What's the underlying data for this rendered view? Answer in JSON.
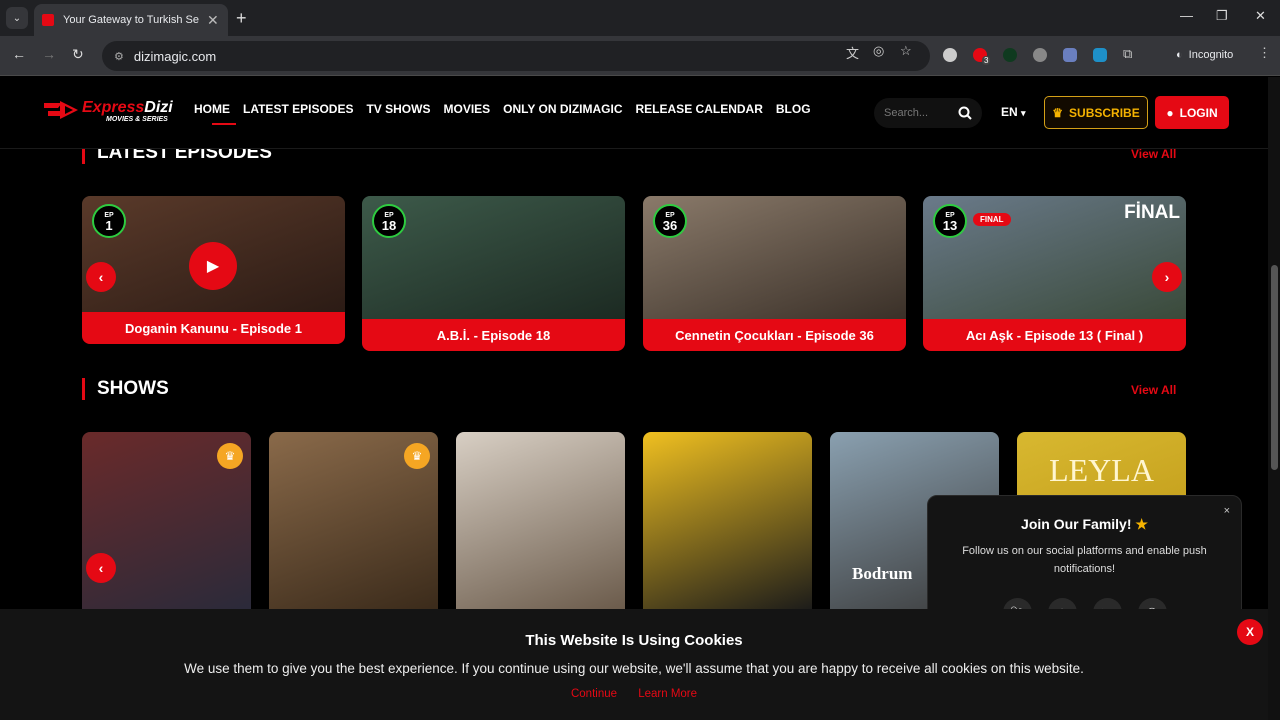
{
  "browser": {
    "tab_title": "Your Gateway to Turkish Series",
    "tab_close": "✕",
    "new_tab": "+",
    "url": "dizimagic.com",
    "incognito_label": "Incognito",
    "window_controls": {
      "minimize": "—",
      "maximize": "❐",
      "close": "✕"
    },
    "extension_badge": "3"
  },
  "header": {
    "logo_express": "Express",
    "logo_dizi": "Dizi",
    "logo_tagline": "MOVIES & SERIES",
    "nav": [
      "HOME",
      "LATEST EPISODES",
      "TV SHOWS",
      "MOVIES",
      "ONLY ON DIZIMAGIC",
      "RELEASE CALENDAR",
      "BLOG"
    ],
    "search_placeholder": "Search...",
    "language": "EN",
    "subscribe_label": "SUBSCRIBE",
    "login_label": "LOGIN"
  },
  "latest": {
    "heading": "LATEST EPISODES",
    "view_all": "View All",
    "ep_label": "EP",
    "final_badge": "FINAL",
    "final_overlay": "FİNAL",
    "items": [
      {
        "episode": "1",
        "title": "Doganin Kanunu - Episode 1",
        "color_a": "#5a3a2a",
        "color_b": "#2a1a14"
      },
      {
        "episode": "18",
        "title": "A.B.İ. - Episode 18",
        "color_a": "#3d5a4a",
        "color_b": "#1c2a22"
      },
      {
        "episode": "36",
        "title": "Cennetin Çocukları - Episode 36",
        "color_a": "#8a7a6a",
        "color_b": "#3a3028"
      },
      {
        "episode": "13",
        "title": "Acı Aşk - Episode 13 ( Final )",
        "color_a": "#6a7a8a",
        "color_b": "#3a4a3a"
      }
    ]
  },
  "shows": {
    "heading": "SHOWS",
    "view_all": "View All",
    "items": [
      {
        "color_a": "#6a2a2a",
        "color_b": "#2a2a3a",
        "premium": true,
        "caption": ""
      },
      {
        "color_a": "#8a6a4a",
        "color_b": "#3a2a1a",
        "premium": true,
        "caption": ""
      },
      {
        "color_a": "#d8cfc4",
        "color_b": "#6a5a4a",
        "premium": false,
        "caption": ""
      },
      {
        "color_a": "#f0c020",
        "color_b": "#1a1a1a",
        "premium": false,
        "caption": ""
      },
      {
        "color_a": "#8aa0b0",
        "color_b": "#3a3a3a",
        "premium": false,
        "caption": "Bodrum"
      },
      {
        "color_a": "#d8b830",
        "color_b": "#b89010",
        "premium": false,
        "caption": "LEYLA"
      }
    ]
  },
  "popup": {
    "title": "Join Our Family!",
    "star": "★",
    "body": "Follow us on our social platforms and enable push notifications!",
    "close": "×",
    "socials": [
      "twitter-icon",
      "instagram-icon",
      "youtube-icon",
      "whatsapp-icon"
    ]
  },
  "cookie": {
    "title": "This Website Is Using Cookies",
    "body": "We use them to give you the best experience. If you continue using our website, we'll assume that you are happy to receive all cookies on this website.",
    "continue": "Continue",
    "learn_more": "Learn More",
    "close": "X"
  },
  "colors": {
    "accent": "#e50914",
    "gold": "#f5b301",
    "badge_green": "#2ecc40"
  }
}
